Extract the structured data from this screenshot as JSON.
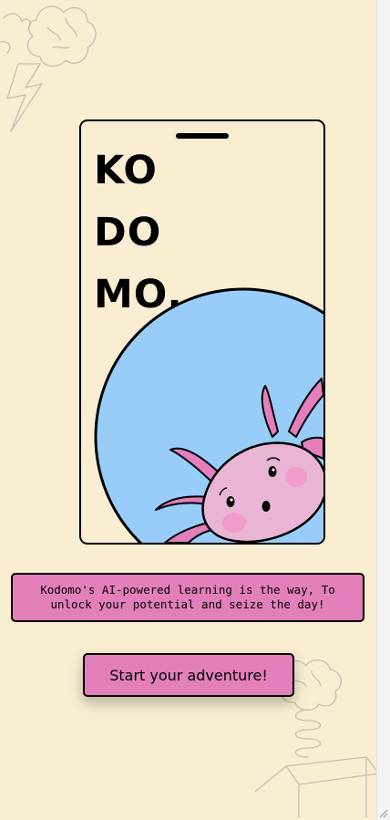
{
  "brand": {
    "logo_lines": [
      "KO",
      "DO",
      "MO."
    ],
    "logo_text": "KO\nDO\nMO."
  },
  "tagline": "Kodomo's AI-powered learning is the way, To unlock your potential and seize the day!",
  "cta": {
    "label": "Start your adventure!"
  },
  "colors": {
    "background": "#f9edd2",
    "accent_pink": "#e37fbb",
    "circle_blue": "#97cdf8",
    "mascot_pink": "#e8b6d4",
    "cheek_pink": "#f19ccd",
    "outline": "#000000",
    "doodle_stroke": "#c9beb2"
  },
  "icons": {
    "top_left_doodle": "brain-lightning-icon",
    "bottom_right_doodle": "brain-spring-box-icon",
    "mascot": "axolotl-illustration"
  }
}
